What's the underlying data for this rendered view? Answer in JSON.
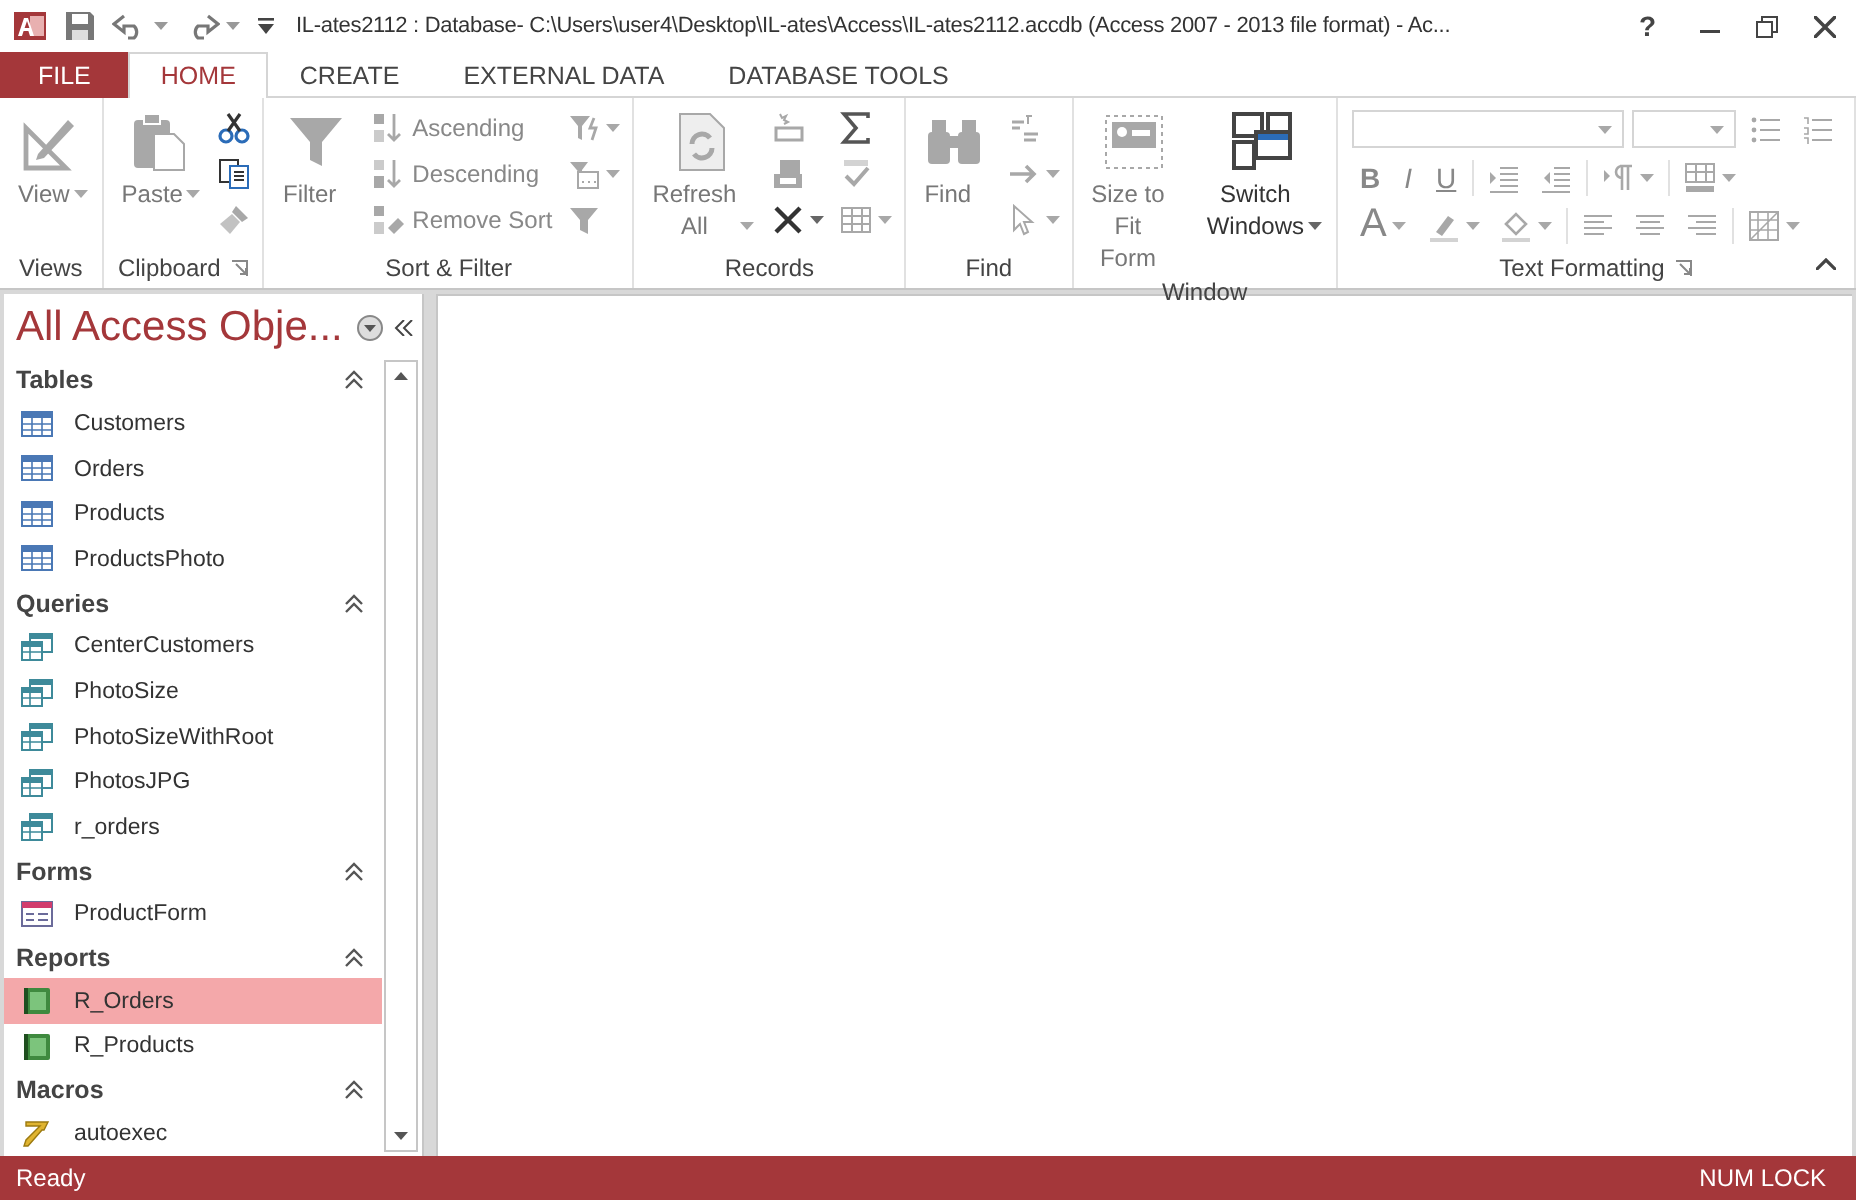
{
  "window": {
    "title": "IL-ates2112 : Database- C:\\Users\\user4\\Desktop\\IL-ates\\Access\\IL-ates2112.accdb (Access 2007 - 2013 file format) - Ac...",
    "help": "?"
  },
  "ribbon_tabs": [
    {
      "label": "FILE",
      "kind": "file",
      "selected": false
    },
    {
      "label": "HOME",
      "kind": "tab",
      "selected": true
    },
    {
      "label": "CREATE",
      "kind": "tab",
      "selected": false
    },
    {
      "label": "EXTERNAL DATA",
      "kind": "tab",
      "selected": false
    },
    {
      "label": "DATABASE TOOLS",
      "kind": "tab",
      "selected": false
    }
  ],
  "ribbon": {
    "groups": [
      {
        "label": "Views",
        "launcher": false,
        "kind": "standard",
        "items": [
          {
            "kind": "large",
            "label": "View",
            "dropdown": true,
            "disabled": true
          }
        ]
      },
      {
        "label": "Clipboard",
        "launcher": true,
        "kind": "standard",
        "items": [
          {
            "kind": "large",
            "label": "Paste",
            "dropdown": true,
            "disabled": true
          },
          {
            "kind": "icon",
            "dropdown": false,
            "disabled": false
          },
          {
            "kind": "icon",
            "dropdown": false,
            "disabled": false
          },
          {
            "kind": "icon",
            "dropdown": false,
            "disabled": true
          }
        ]
      },
      {
        "label": "Sort & Filter",
        "launcher": false,
        "kind": "standard",
        "items": [
          {
            "kind": "large",
            "label": "Filter",
            "dropdown": false,
            "disabled": true
          },
          {
            "kind": "small",
            "label": "Ascending",
            "dropdown": false,
            "disabled": true
          },
          {
            "kind": "small",
            "label": "Descending",
            "dropdown": false,
            "disabled": true
          },
          {
            "kind": "small",
            "label": "Remove Sort",
            "dropdown": false,
            "disabled": true
          },
          {
            "kind": "icon",
            "dropdown": true,
            "disabled": true
          },
          {
            "kind": "icon",
            "dropdown": true,
            "disabled": true
          },
          {
            "kind": "icon",
            "dropdown": false,
            "disabled": true
          }
        ]
      },
      {
        "label": "Records",
        "launcher": false,
        "kind": "standard",
        "items": [
          {
            "kind": "large",
            "label": "Refresh All",
            "dropdown": true,
            "disabled": true
          },
          {
            "kind": "icon",
            "dropdown": false,
            "disabled": true
          },
          {
            "kind": "icon",
            "dropdown": false,
            "disabled": true
          },
          {
            "kind": "icon",
            "dropdown": true,
            "disabled": false
          },
          {
            "kind": "icon",
            "dropdown": false,
            "disabled": false
          },
          {
            "kind": "icon",
            "dropdown": false,
            "disabled": true
          },
          {
            "kind": "icon",
            "dropdown": true,
            "disabled": true
          }
        ]
      },
      {
        "label": "Find",
        "launcher": false,
        "kind": "standard",
        "items": [
          {
            "kind": "large",
            "label": "Find",
            "dropdown": false,
            "disabled": true
          },
          {
            "kind": "icon",
            "dropdown": false,
            "disabled": true
          },
          {
            "kind": "icon",
            "dropdown": true,
            "disabled": true
          },
          {
            "kind": "icon",
            "dropdown": true,
            "disabled": true
          }
        ]
      },
      {
        "label": "Window",
        "launcher": false,
        "kind": "standard",
        "items": [
          {
            "kind": "large",
            "label": "Size to Fit Form",
            "dropdown": false,
            "disabled": true
          },
          {
            "kind": "large",
            "label": "Switch Windows",
            "dropdown": true,
            "disabled": false
          }
        ]
      },
      {
        "label": "Text Formatting",
        "launcher": true,
        "kind": "formatting",
        "items": [
          {
            "kind": "combo",
            "dropdown": true,
            "disabled": true
          },
          {
            "kind": "combo",
            "dropdown": true,
            "disabled": true
          },
          {
            "kind": "icon",
            "dropdown": false,
            "disabled": true
          },
          {
            "kind": "icon",
            "dropdown": false,
            "disabled": true
          },
          {
            "kind": "glyph",
            "label": "B",
            "dropdown": false,
            "disabled": true
          },
          {
            "kind": "glyph",
            "label": "I",
            "dropdown": false,
            "disabled": true
          },
          {
            "kind": "glyph",
            "label": "U",
            "dropdown": false,
            "disabled": true
          },
          {
            "kind": "icon",
            "dropdown": false,
            "disabled": true
          },
          {
            "kind": "icon",
            "dropdown": false,
            "disabled": true
          },
          {
            "kind": "icon",
            "dropdown": true,
            "disabled": true
          },
          {
            "kind": "icon",
            "dropdown": true,
            "disabled": true
          },
          {
            "kind": "glyph",
            "label": "A",
            "dropdown": true,
            "disabled": true
          },
          {
            "kind": "icon",
            "dropdown": true,
            "disabled": true
          },
          {
            "kind": "icon",
            "dropdown": true,
            "disabled": true
          },
          {
            "kind": "icon",
            "dropdown": false,
            "disabled": true
          },
          {
            "kind": "icon",
            "dropdown": false,
            "disabled": true
          },
          {
            "kind": "icon",
            "dropdown": false,
            "disabled": true
          },
          {
            "kind": "icon",
            "dropdown": true,
            "disabled": true
          }
        ]
      }
    ]
  },
  "navigation_pane": {
    "title": "All Access Obje...",
    "groups": [
      {
        "label": "Tables",
        "kind": "table",
        "expanded": true,
        "items": [
          {
            "label": "Customers",
            "selected": false
          },
          {
            "label": "Orders",
            "selected": false
          },
          {
            "label": "Products",
            "selected": false
          },
          {
            "label": "ProductsPhoto",
            "selected": false
          }
        ]
      },
      {
        "label": "Queries",
        "kind": "query",
        "expanded": true,
        "items": [
          {
            "label": "CenterCustomers",
            "selected": false
          },
          {
            "label": "PhotoSize",
            "selected": false
          },
          {
            "label": "PhotoSizeWithRoot",
            "selected": false
          },
          {
            "label": "PhotosJPG",
            "selected": false
          },
          {
            "label": "r_orders",
            "selected": false
          }
        ]
      },
      {
        "label": "Forms",
        "kind": "form",
        "expanded": true,
        "items": [
          {
            "label": "ProductForm",
            "selected": false
          }
        ]
      },
      {
        "label": "Reports",
        "kind": "report",
        "expanded": true,
        "items": [
          {
            "label": "R_Orders",
            "selected": true
          },
          {
            "label": "R_Products",
            "selected": false
          }
        ]
      },
      {
        "label": "Macros",
        "kind": "macro",
        "expanded": true,
        "items": [
          {
            "label": "autoexec",
            "selected": false
          }
        ]
      }
    ]
  },
  "status_bar": {
    "left": "Ready",
    "right": "NUM LOCK"
  }
}
